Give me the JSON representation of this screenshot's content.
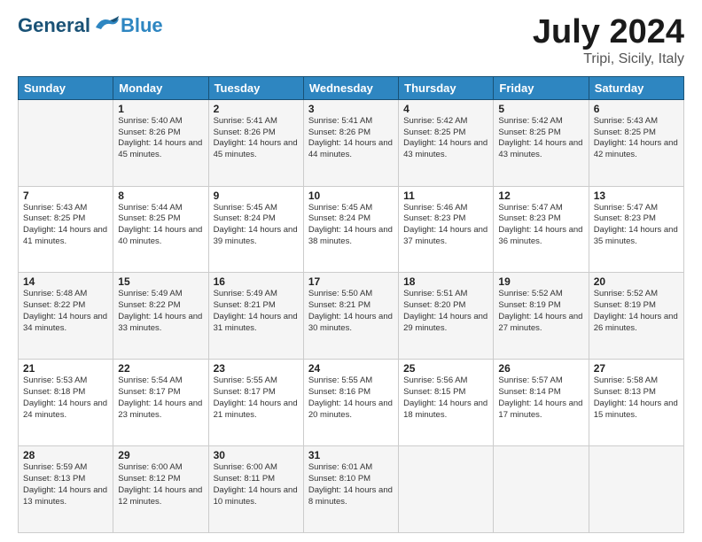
{
  "header": {
    "logo_general": "General",
    "logo_blue": "Blue",
    "month_title": "July 2024",
    "location": "Tripi, Sicily, Italy"
  },
  "columns": [
    "Sunday",
    "Monday",
    "Tuesday",
    "Wednesday",
    "Thursday",
    "Friday",
    "Saturday"
  ],
  "weeks": [
    [
      {
        "day": "",
        "info": ""
      },
      {
        "day": "1",
        "info": "Sunrise: 5:40 AM\nSunset: 8:26 PM\nDaylight: 14 hours\nand 45 minutes."
      },
      {
        "day": "2",
        "info": "Sunrise: 5:41 AM\nSunset: 8:26 PM\nDaylight: 14 hours\nand 45 minutes."
      },
      {
        "day": "3",
        "info": "Sunrise: 5:41 AM\nSunset: 8:26 PM\nDaylight: 14 hours\nand 44 minutes."
      },
      {
        "day": "4",
        "info": "Sunrise: 5:42 AM\nSunset: 8:25 PM\nDaylight: 14 hours\nand 43 minutes."
      },
      {
        "day": "5",
        "info": "Sunrise: 5:42 AM\nSunset: 8:25 PM\nDaylight: 14 hours\nand 43 minutes."
      },
      {
        "day": "6",
        "info": "Sunrise: 5:43 AM\nSunset: 8:25 PM\nDaylight: 14 hours\nand 42 minutes."
      }
    ],
    [
      {
        "day": "7",
        "info": "Sunrise: 5:43 AM\nSunset: 8:25 PM\nDaylight: 14 hours\nand 41 minutes."
      },
      {
        "day": "8",
        "info": "Sunrise: 5:44 AM\nSunset: 8:25 PM\nDaylight: 14 hours\nand 40 minutes."
      },
      {
        "day": "9",
        "info": "Sunrise: 5:45 AM\nSunset: 8:24 PM\nDaylight: 14 hours\nand 39 minutes."
      },
      {
        "day": "10",
        "info": "Sunrise: 5:45 AM\nSunset: 8:24 PM\nDaylight: 14 hours\nand 38 minutes."
      },
      {
        "day": "11",
        "info": "Sunrise: 5:46 AM\nSunset: 8:23 PM\nDaylight: 14 hours\nand 37 minutes."
      },
      {
        "day": "12",
        "info": "Sunrise: 5:47 AM\nSunset: 8:23 PM\nDaylight: 14 hours\nand 36 minutes."
      },
      {
        "day": "13",
        "info": "Sunrise: 5:47 AM\nSunset: 8:23 PM\nDaylight: 14 hours\nand 35 minutes."
      }
    ],
    [
      {
        "day": "14",
        "info": "Sunrise: 5:48 AM\nSunset: 8:22 PM\nDaylight: 14 hours\nand 34 minutes."
      },
      {
        "day": "15",
        "info": "Sunrise: 5:49 AM\nSunset: 8:22 PM\nDaylight: 14 hours\nand 33 minutes."
      },
      {
        "day": "16",
        "info": "Sunrise: 5:49 AM\nSunset: 8:21 PM\nDaylight: 14 hours\nand 31 minutes."
      },
      {
        "day": "17",
        "info": "Sunrise: 5:50 AM\nSunset: 8:21 PM\nDaylight: 14 hours\nand 30 minutes."
      },
      {
        "day": "18",
        "info": "Sunrise: 5:51 AM\nSunset: 8:20 PM\nDaylight: 14 hours\nand 29 minutes."
      },
      {
        "day": "19",
        "info": "Sunrise: 5:52 AM\nSunset: 8:19 PM\nDaylight: 14 hours\nand 27 minutes."
      },
      {
        "day": "20",
        "info": "Sunrise: 5:52 AM\nSunset: 8:19 PM\nDaylight: 14 hours\nand 26 minutes."
      }
    ],
    [
      {
        "day": "21",
        "info": "Sunrise: 5:53 AM\nSunset: 8:18 PM\nDaylight: 14 hours\nand 24 minutes."
      },
      {
        "day": "22",
        "info": "Sunrise: 5:54 AM\nSunset: 8:17 PM\nDaylight: 14 hours\nand 23 minutes."
      },
      {
        "day": "23",
        "info": "Sunrise: 5:55 AM\nSunset: 8:17 PM\nDaylight: 14 hours\nand 21 minutes."
      },
      {
        "day": "24",
        "info": "Sunrise: 5:55 AM\nSunset: 8:16 PM\nDaylight: 14 hours\nand 20 minutes."
      },
      {
        "day": "25",
        "info": "Sunrise: 5:56 AM\nSunset: 8:15 PM\nDaylight: 14 hours\nand 18 minutes."
      },
      {
        "day": "26",
        "info": "Sunrise: 5:57 AM\nSunset: 8:14 PM\nDaylight: 14 hours\nand 17 minutes."
      },
      {
        "day": "27",
        "info": "Sunrise: 5:58 AM\nSunset: 8:13 PM\nDaylight: 14 hours\nand 15 minutes."
      }
    ],
    [
      {
        "day": "28",
        "info": "Sunrise: 5:59 AM\nSunset: 8:13 PM\nDaylight: 14 hours\nand 13 minutes."
      },
      {
        "day": "29",
        "info": "Sunrise: 6:00 AM\nSunset: 8:12 PM\nDaylight: 14 hours\nand 12 minutes."
      },
      {
        "day": "30",
        "info": "Sunrise: 6:00 AM\nSunset: 8:11 PM\nDaylight: 14 hours\nand 10 minutes."
      },
      {
        "day": "31",
        "info": "Sunrise: 6:01 AM\nSunset: 8:10 PM\nDaylight: 14 hours\nand 8 minutes."
      },
      {
        "day": "",
        "info": ""
      },
      {
        "day": "",
        "info": ""
      },
      {
        "day": "",
        "info": ""
      }
    ]
  ]
}
